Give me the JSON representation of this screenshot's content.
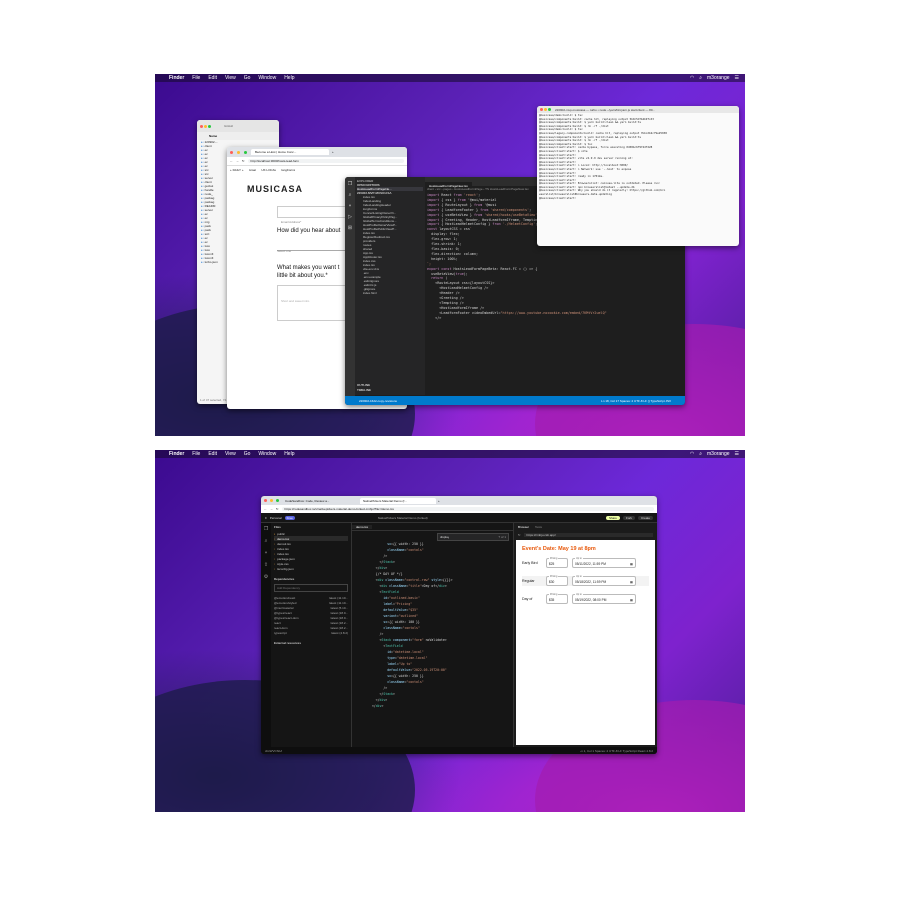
{
  "top": {
    "menubar": {
      "app": "Finder",
      "items": [
        "File",
        "Edit",
        "View",
        "Go",
        "Window",
        "Help"
      ],
      "user": "m3orange"
    },
    "github_window": {
      "title": "GitHub",
      "sidebar_label": "Name",
      "folders": [
        "220902-...",
        "client",
        "ec",
        "ec",
        "ec",
        "ec",
        "ec",
        "src",
        "src",
        "server",
        "client",
        "getAut",
        "handle",
        "node_",
        "packag",
        "packag",
        "READM",
        "server",
        "ec",
        "ec",
        "mig",
        "pack",
        "pack",
        "scri",
        "ec",
        "ec",
        "tsco",
        "tsco",
        "tsconfi",
        "tsconfi",
        "turbo.json"
      ],
      "status": "1 of 47 selected, 74.89 GB available"
    },
    "browser": {
      "tab1": "Become a Host | Home Conc...",
      "url": "http://localhost:3000/hosts-lead-form",
      "bookmarks": [
        "+ DAILY +",
        "Gmail",
        "UK LOCAL",
        "longForms"
      ],
      "logo": "MUSICASA",
      "email_placeholder": "Email Address*",
      "question1": "How did you hear about",
      "select_placeholder": "Select one",
      "question2": "What makes you want t",
      "question2_line2": "little bit about you.*",
      "textarea_placeholder": "Short and sweet intro"
    },
    "terminal": {
      "title": "220902-mvp-musicasa — turbo • node ~/yarn/bin/yarn.js start:client — 80...",
      "lines": [
        "@musicasa/demo:build: $ tsc",
        "@musicasa/components:build: cache hit, replaying output 5b9c5d7b4b9fcd3",
        "@musicasa/components:build: $ yarn build:clean && yarn build:ts",
        "@musicasa/components:build: $ rm -rf ./dist",
        "@musicasa/demo:build: $ tsc",
        "@musicasa/legacy-components:build: cache hit, replaying output 7bbcdb2c79e25938",
        "@musicasa/components:build: $ yarn build:clean && yarn build:ts",
        "@musicasa/components:build: $ rm -rf ./dist",
        "@musicasa/components:build: $ tsc",
        "@musicasa/client:start: cache bypass, force executing 0458bc6f974df228",
        "@musicasa/client:start: $ vite",
        "@musicasa/client:start:",
        "@musicasa/client:start:   vite v2.9.9 dev server running at:",
        "@musicasa/client:start:",
        "@musicasa/client:start:   > Local: http://localhost:3000/",
        "@musicasa/client:start:   > Network: use `--host` to expose",
        "@musicasa/client:start:",
        "@musicasa/client:start:   ready in 1701ms.",
        "@musicasa/client:start:",
        "@musicasa/client:start: Browserslist: caniuse-lite is outdated. Please run:",
        "@musicasa/client:start:   npx browserslist@latest --update-db",
        "@musicasa/client:start:   Why you should do it regularly: https://github.com/bro",
        "wserslist/browserslist#browsers-data-updating",
        "@musicasa/client:start:"
      ]
    },
    "vscode": {
      "explorer_title": "EXPLORER",
      "open_editors": "OPEN EDITORS",
      "active_file": "HostsLeadFormPageNe...",
      "workspace": "220902-MVP-MUSICASA",
      "tab": "HostsLeadFormPageNew.tsx",
      "breadcrumb": "client › src › pages › HostsLeadFormPage › TS HostsLeadFormPageNew.tsx",
      "files": [
        "index.tsx",
        "IndexLanding",
        "IndexLandingHeader",
        "longForms",
        "ConcertListingOwnerVi...",
        "GlobalPrivacyPolicyPag...",
        "GlobalTermsConditions...",
        "HostProfileOwnerViewP...",
        "HostProfilePublicViewP...",
        "index.tsx",
        "RegisterRedirect.tsx",
        "providers",
        "routes",
        "shared",
        "App.tsx",
        "AppRouter.tsx",
        "index.css",
        "index.tsx",
        "vite-env.d.ts",
        ".env",
        ".env.example",
        ".eslintignore",
        ".eslintrc.js",
        ".gitignore",
        "index.html"
      ],
      "outline": "OUTLINE",
      "timeline": "TIMELINE",
      "status_left": "220902-1622-copy-revisions",
      "status_right": "Ln 18, Col 17   Spaces: 2   UTF-8   LF   {} TypeScript JSX",
      "code": [
        "import React from 'react';",
        "import { css } from '@mui/material",
        "",
        "import { RouteLayout } from '@musi",
        "",
        "import { LeadformFooter } from 'shared/components';",
        "import { useBetaView } from 'shared/hooks/useBetaView';",
        "",
        "import { Greeting, Header, HostLeadformIframe, Tempting } from './components';",
        "import { HostLeadHelmetConfig } from './HelmetConfig';",
        "",
        "const layoutCSS = css`",
        "  display: flex;",
        "  flex-grow: 1;",
        "  flex-shrink: 1;",
        "  flex-basis: 0;",
        "  flex-direction: column;",
        "  height: 100%;",
        "`;",
        "",
        "export const HostsLeadFormPageBeta: React.FC = () => {",
        "  useBetaView(true);",
        "  return (",
        "    <RouteLayout css={layoutCSS}>",
        "      <HostLeadHelmetConfig />",
        "      <Header />",
        "      <Greeting />",
        "      <Tempting />",
        "      <HostLeadformIframe />",
        "      <LeadformFooter videoEmbedUrl=\"https://www.youtube-nocookie.com/embed/7KMtVr2uelQ\"",
        "    </>"
      ]
    }
  },
  "bottom": {
    "menubar": {
      "app": "Finder",
      "items": [
        "File",
        "Edit",
        "View",
        "Go",
        "Window",
        "Help"
      ],
      "user": "m3orange"
    },
    "browser": {
      "tab1": "CodeSandbox: Code, Review a...",
      "tab2": "NativePickers Material Demo (f...",
      "url": "https://codesandbox.io/s/nativepickers-material-demo-forked-cmbju?file=/demo.tsx"
    },
    "codesandbox": {
      "workspace": "Personal",
      "badge": "Free",
      "project": "NativePickers Material Demo (forked)",
      "share": "Share",
      "fork": "Fork",
      "create": "Create",
      "files_title": "Files",
      "files": [
        "public",
        "demo.tsx",
        "demo2.tsx",
        "index.tsx",
        "index.tsx",
        "package.json",
        "style.css",
        "tsconfig.json"
      ],
      "deps_title": "Dependencies",
      "deps_search": "Add Dependency",
      "deps": [
        [
          "@emotion/react",
          "latest (11.10..."
        ],
        [
          "@emotion/styled",
          "latest (11.10..."
        ],
        [
          "@mui/material",
          "latest (5.10..."
        ],
        [
          "@types/react",
          "latest (18.0..."
        ],
        [
          "@types/react-dom",
          "latest (18.0..."
        ],
        [
          "react",
          "latest (18.2..."
        ],
        [
          "react-dom",
          "latest (18.2..."
        ],
        [
          "typescript",
          "latest (4.8.2)"
        ]
      ],
      "external": "External resources",
      "editor_tab": "demo.tsx",
      "find_text": "display",
      "find_count": "? of 1",
      "code": [
        "          sx={{ width: 250 }}",
        "          className=\"contols\"",
        "        />",
        "      </Stack>",
        "    </div>",
        "",
        "    {/* DAY OF */}",
        "    <div className=\"control-row\" style={{}}>",
        "      <div className=\"title\">Day of</div>",
        "      <TextField",
        "        id=\"outlined-basic\"",
        "        label=\"Pricing\"",
        "        defaultValue=\"$35\"",
        "        variant=\"outlined\"",
        "        sx={{ width: 100 }}",
        "        className=\"contols\"",
        "      />",
        "",
        "      <Stack component=\"form\" noValidate>",
        "        <TextField",
        "          id=\"datetime-local\"",
        "          type=\"datetime-local\"",
        "          label=\"Up to\"",
        "          defaultValue=\"2022-05-19T20:00\"",
        "          sx={{ width: 250 }}",
        "          className=\"contols\"",
        "        />",
        "      </Stack>",
        "",
        "    </div>",
        "  </div>"
      ],
      "preview_tab": "Browser",
      "preview_tab2": "Tests",
      "preview_url": "https://cmbju.csb.app/",
      "event_title": "Event's Date: May 19 at 8pm",
      "rows": [
        {
          "title": "Early Bird",
          "price": "$25",
          "date": "05/11/2022, 11:59 PM"
        },
        {
          "title": "Regular",
          "price": "$30",
          "date": "05/18/2022, 11:59 PM"
        },
        {
          "title": "Day of",
          "price": "$35",
          "date": "05/19/2022, 08:00 PM"
        }
      ],
      "pricing_label": "Pricing",
      "upto_label": "Up to",
      "status_left": "cbsWVCSbA",
      "status_right": "Ln 1, Col 1   Spaces: 2   UTF-8   LF   TypeScript React   4.8.2"
    }
  },
  "colors": {
    "accent_orange": "#e8590c",
    "vscode_bg": "#1e1e1e",
    "csb_bg": "#151515",
    "status_blue": "#007acc"
  }
}
